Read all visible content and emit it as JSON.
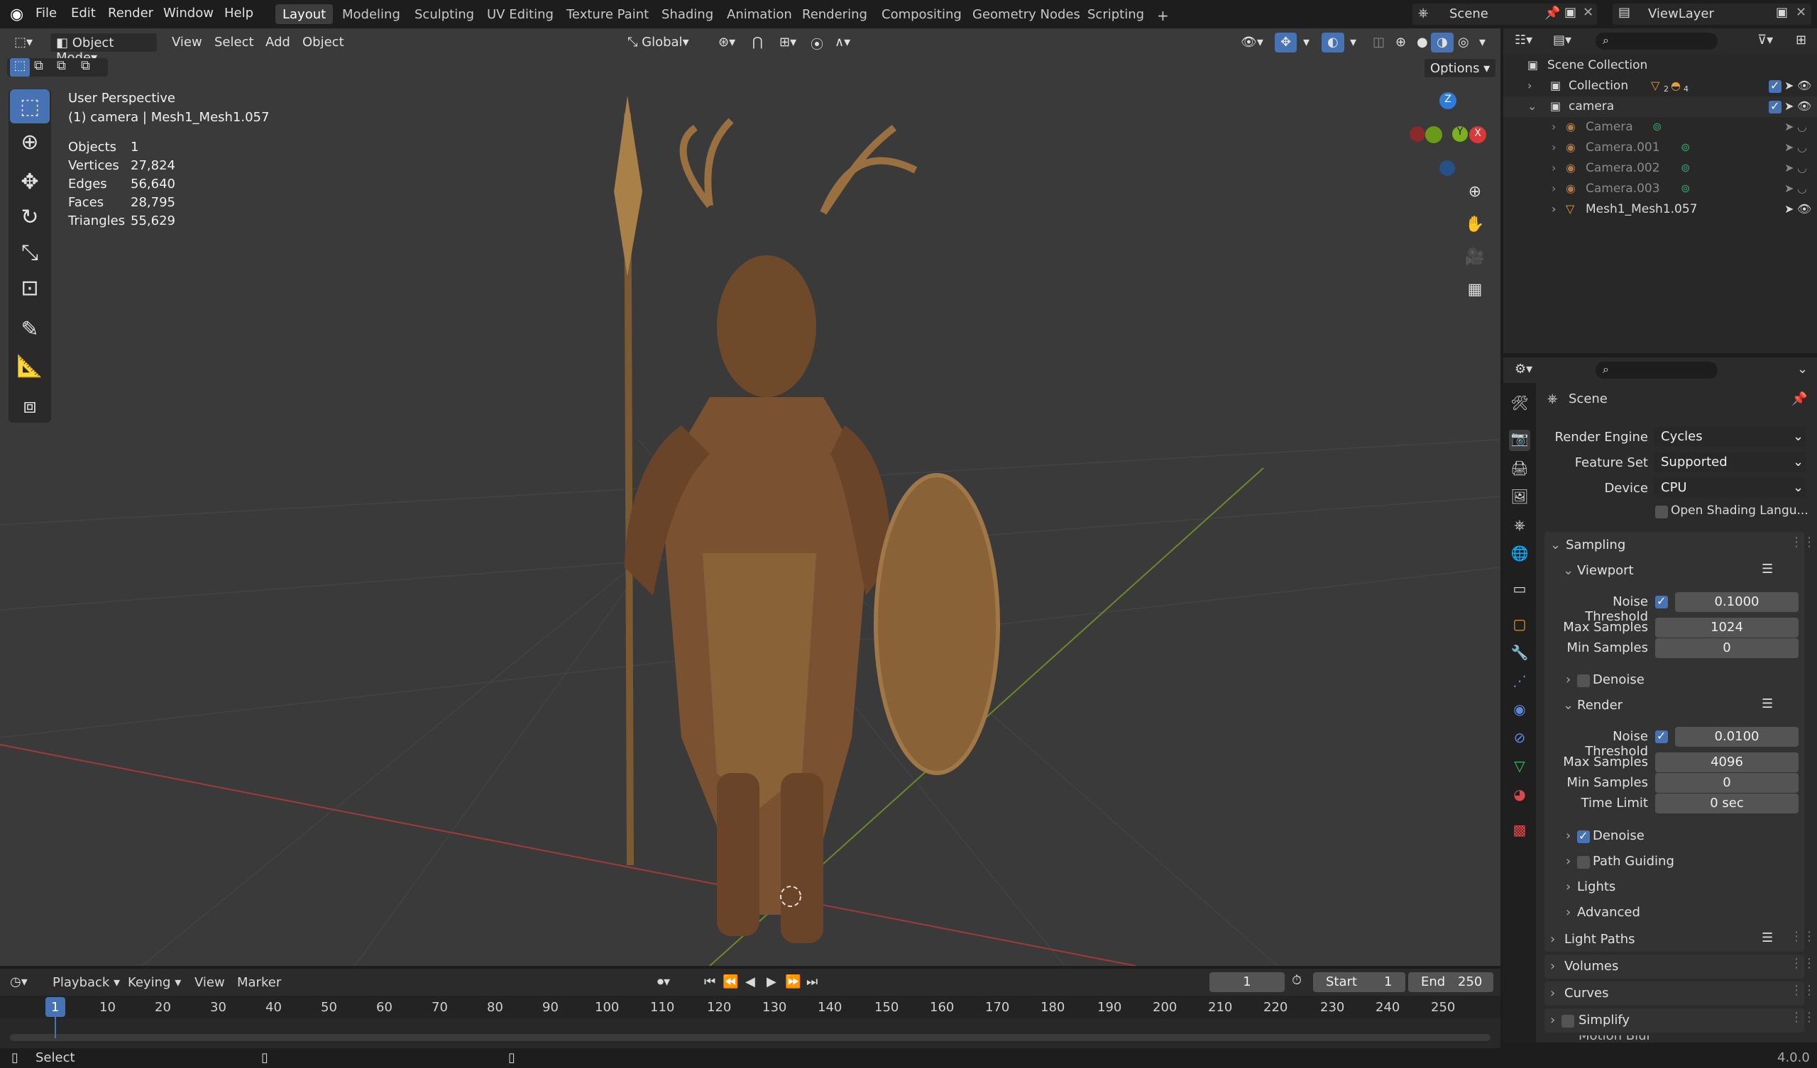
{
  "topbar": {
    "menus": [
      "File",
      "Edit",
      "Render",
      "Window",
      "Help"
    ],
    "workspaces": [
      "Layout",
      "Modeling",
      "Sculpting",
      "UV Editing",
      "Texture Paint",
      "Shading",
      "Animation",
      "Rendering",
      "Compositing",
      "Geometry Nodes",
      "Scripting"
    ],
    "active_workspace": "Layout",
    "add_tab": "+",
    "scene_name": "Scene",
    "view_layer": "ViewLayer"
  },
  "viewport_header": {
    "mode": "Object Mode",
    "menus": [
      "View",
      "Select",
      "Add",
      "Object"
    ],
    "orientation": "Global",
    "options": "Options"
  },
  "viewport_info": {
    "view_name": "User Perspective",
    "object_line": "(1) camera | Mesh1_Mesh1.057",
    "stats": [
      {
        "label": "Objects",
        "value": "1"
      },
      {
        "label": "Vertices",
        "value": "27,824"
      },
      {
        "label": "Edges",
        "value": "56,640"
      },
      {
        "label": "Faces",
        "value": "28,795"
      },
      {
        "label": "Triangles",
        "value": "55,629"
      }
    ]
  },
  "gizmo": {
    "z": "Z",
    "y": "Y",
    "x": "X"
  },
  "outliner": {
    "root": "Scene Collection",
    "rows": [
      {
        "name": "Collection",
        "badge": "2",
        "badge2": "4"
      },
      {
        "name": "camera"
      },
      {
        "name": "Camera"
      },
      {
        "name": "Camera.001"
      },
      {
        "name": "Camera.002"
      },
      {
        "name": "Camera.003"
      },
      {
        "name": "Mesh1_Mesh1.057"
      }
    ]
  },
  "properties": {
    "context": "Scene",
    "render_engine_label": "Render Engine",
    "render_engine": "Cycles",
    "feature_set_label": "Feature Set",
    "feature_set": "Supported",
    "device_label": "Device",
    "device": "CPU",
    "osl_label": "Open Shading Langu...",
    "sampling": "Sampling",
    "viewport": "Viewport",
    "vp_noise_label": "Noise Threshold",
    "vp_noise": "0.1000",
    "vp_max_label": "Max Samples",
    "vp_max": "1024",
    "vp_min_label": "Min Samples",
    "vp_min": "0",
    "vp_denoise": "Denoise",
    "render": "Render",
    "r_noise_label": "Noise Threshold",
    "r_noise": "0.0100",
    "r_max_label": "Max Samples",
    "r_max": "4096",
    "r_min_label": "Min Samples",
    "r_min": "0",
    "time_limit_label": "Time Limit",
    "time_limit": "0 sec",
    "r_denoise": "Denoise",
    "path_guiding": "Path Guiding",
    "lights": "Lights",
    "advanced": "Advanced",
    "light_paths": "Light Paths",
    "volumes": "Volumes",
    "curves": "Curves",
    "simplify": "Simplify",
    "motion_blur": "Motion Blur"
  },
  "timeline": {
    "menus": [
      "Playback",
      "Keying",
      "View",
      "Marker"
    ],
    "current_frame": "1",
    "start_label": "Start",
    "start": "1",
    "end_label": "End",
    "end": "250",
    "ticks": [
      "1",
      "10",
      "20",
      "30",
      "40",
      "50",
      "60",
      "70",
      "80",
      "90",
      "100",
      "110",
      "120",
      "130",
      "140",
      "150",
      "160",
      "170",
      "180",
      "190",
      "200",
      "210",
      "220",
      "230",
      "240",
      "250"
    ]
  },
  "status": {
    "left": "Select",
    "version": "4.0.0"
  }
}
